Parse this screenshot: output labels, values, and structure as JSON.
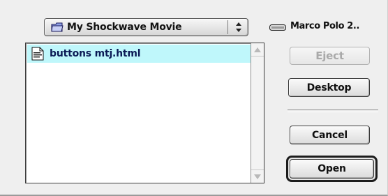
{
  "folder_popup": {
    "label": "My Shockwave Movie",
    "icon": "folder-icon",
    "arrows": "updown-arrows-icon"
  },
  "volume": {
    "label": "Marco Polo 2..",
    "icon": "disk-icon"
  },
  "file_list": {
    "items": [
      {
        "name": "buttons mtj.html",
        "icon": "html-document-icon",
        "selected": true
      }
    ]
  },
  "buttons": {
    "eject": {
      "label": "Eject",
      "enabled": false
    },
    "desktop": {
      "label": "Desktop"
    },
    "cancel": {
      "label": "Cancel"
    },
    "open": {
      "label": "Open",
      "default": true
    }
  },
  "colors": {
    "selection": "#bff7fb",
    "dialog_bg": "#efefef"
  }
}
